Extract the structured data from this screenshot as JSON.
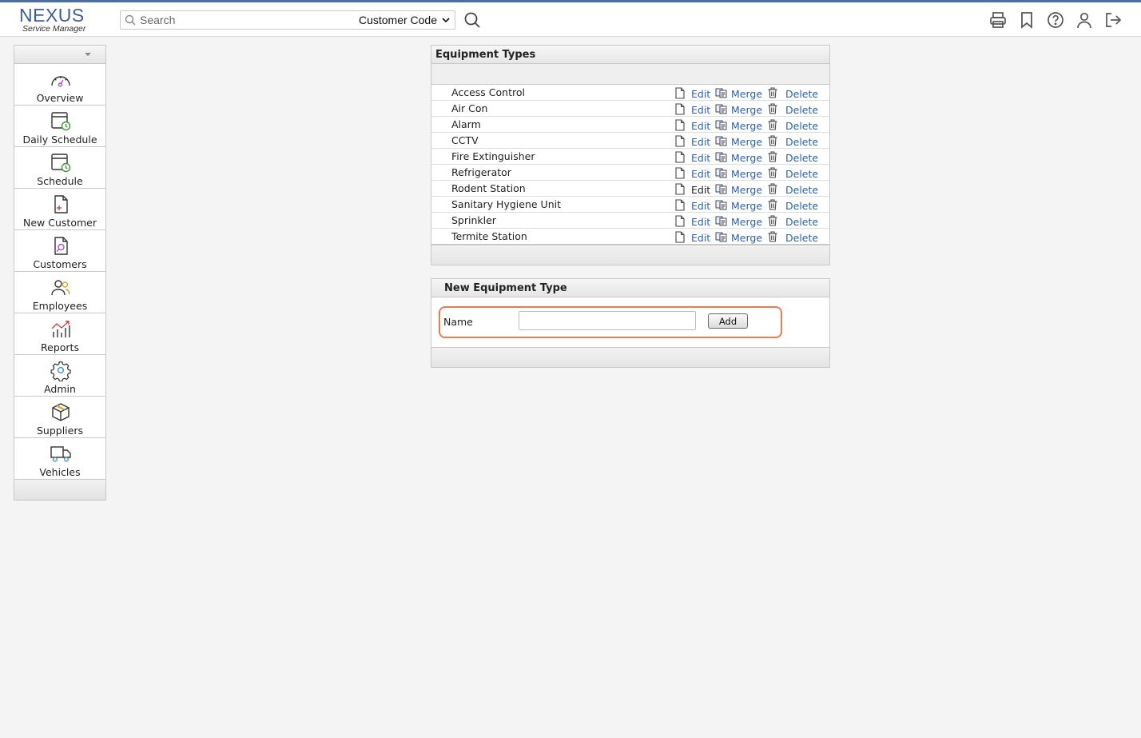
{
  "header": {
    "brand": "NEXUS",
    "brand_sub": "Service Manager",
    "search_placeholder": "Search",
    "search_scope": "Customer Code",
    "icons": [
      "printer-icon",
      "bookmark-icon",
      "help-icon",
      "user-icon",
      "logout-icon"
    ]
  },
  "sidebar": {
    "items": [
      {
        "label": "Overview",
        "icon": "dashboard-icon"
      },
      {
        "label": "Daily Schedule",
        "icon": "calendar-clock-icon"
      },
      {
        "label": "Schedule",
        "icon": "calendar-clock-icon"
      },
      {
        "label": "New Customer",
        "icon": "new-document-icon"
      },
      {
        "label": "Customers",
        "icon": "search-document-icon"
      },
      {
        "label": "Employees",
        "icon": "people-icon"
      },
      {
        "label": "Reports",
        "icon": "chart-icon"
      },
      {
        "label": "Admin",
        "icon": "gear-icon"
      },
      {
        "label": "Suppliers",
        "icon": "box-icon"
      },
      {
        "label": "Vehicles",
        "icon": "truck-icon"
      }
    ]
  },
  "equipment_panel": {
    "title": "Equipment Types",
    "edit_label": "Edit",
    "merge_label": "Merge",
    "delete_label": "Delete",
    "rows": [
      "Access Control",
      "Air Con",
      "Alarm",
      "CCTV",
      "Fire Extinguisher",
      "Refrigerator",
      "Rodent Station",
      "Sanitary Hygiene Unit",
      "Sprinkler",
      "Termite Station"
    ]
  },
  "new_panel": {
    "title": "New Equipment Type",
    "name_label": "Name",
    "name_value": "",
    "add_label": "Add"
  },
  "colors": {
    "brand": "#3d5f96",
    "link": "#2b63a8",
    "highlight": "#f07a4a"
  }
}
